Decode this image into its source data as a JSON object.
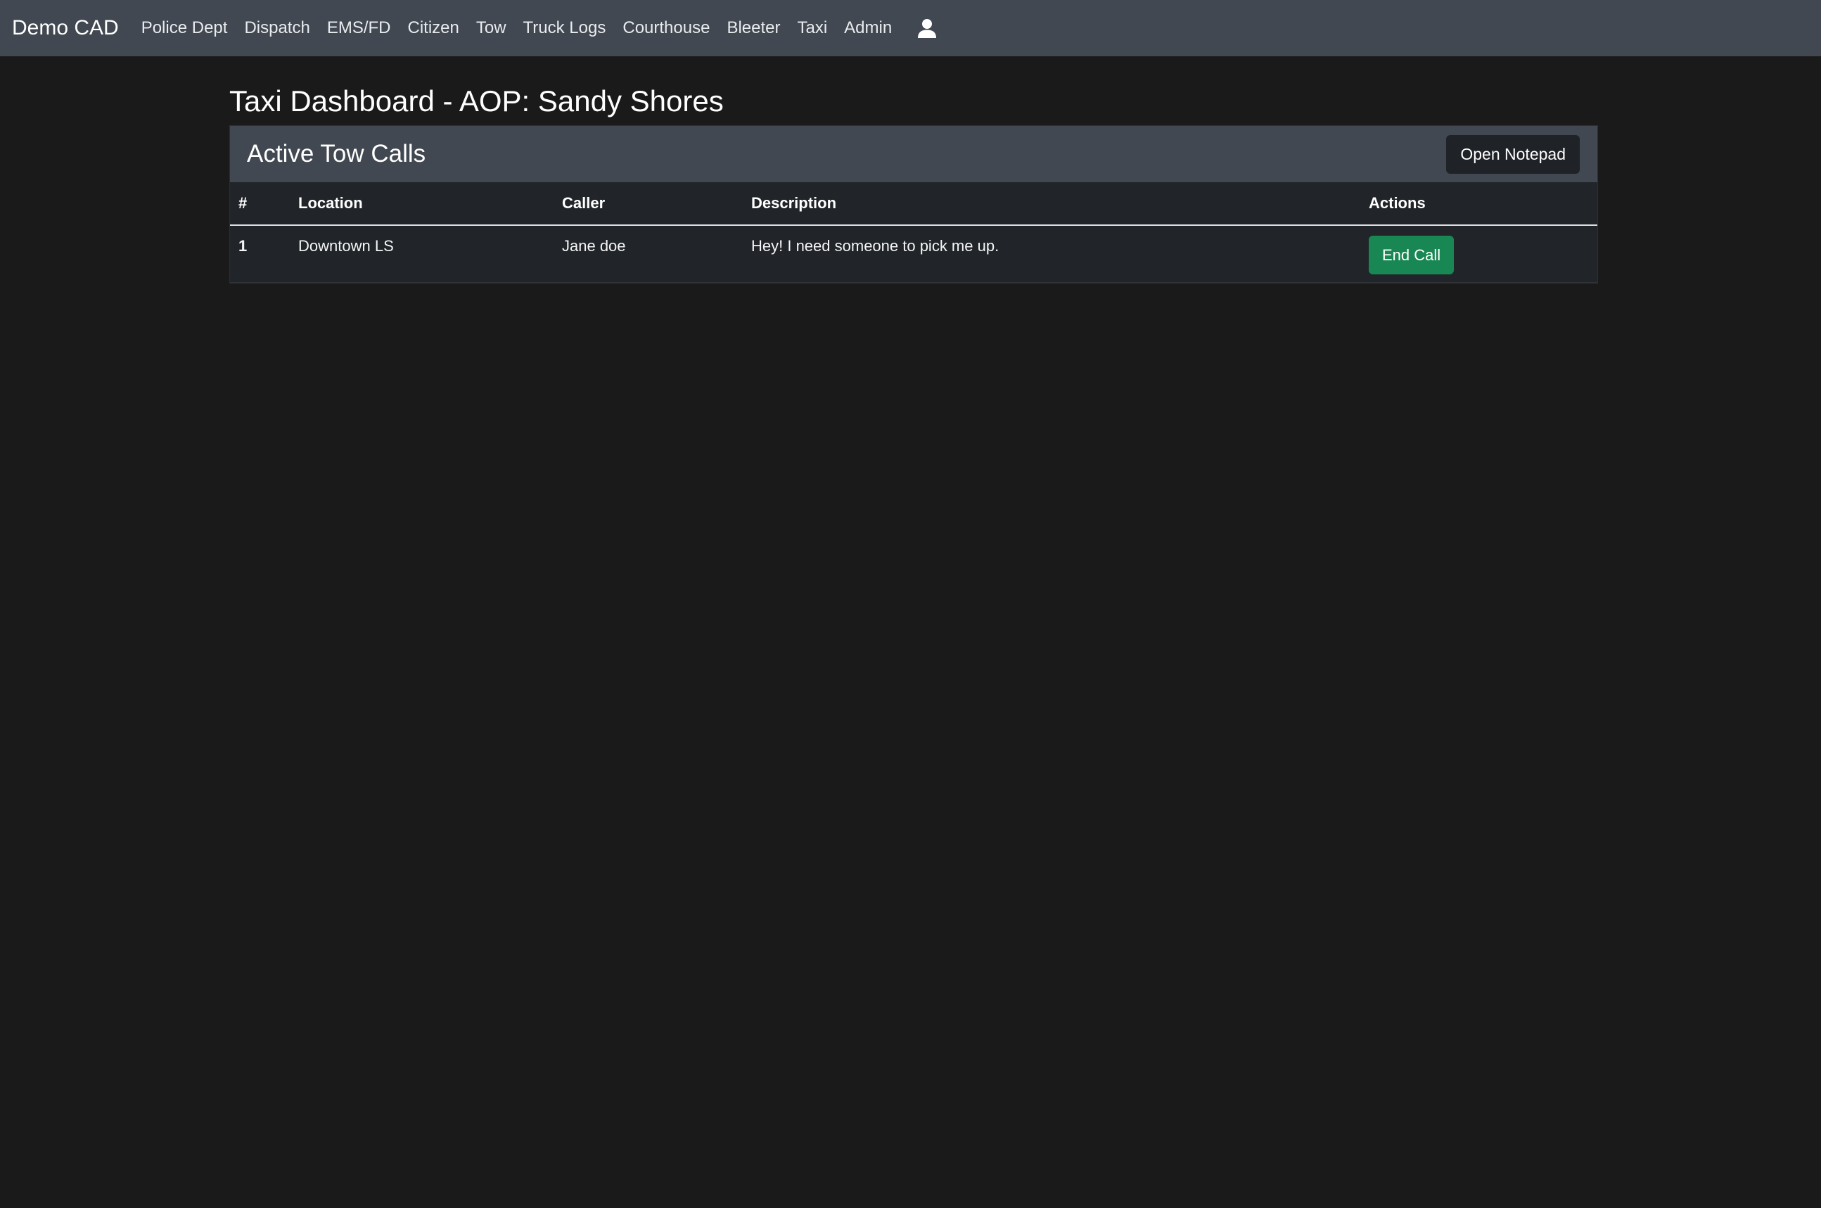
{
  "navbar": {
    "brand": "Demo CAD",
    "links": [
      "Police Dept",
      "Dispatch",
      "EMS/FD",
      "Citizen",
      "Tow",
      "Truck Logs",
      "Courthouse",
      "Bleeter",
      "Taxi",
      "Admin"
    ],
    "user_icon": "person-icon"
  },
  "page": {
    "title": "Taxi Dashboard - AOP: Sandy Shores"
  },
  "card": {
    "title": "Active Tow Calls",
    "notepad_button": "Open Notepad",
    "columns": [
      "#",
      "Location",
      "Caller",
      "Description",
      "Actions"
    ],
    "rows": [
      {
        "num": "1",
        "location": "Downtown LS",
        "caller": "Jane doe",
        "description": "Hey! I need someone to pick me up.",
        "action": "End Call"
      }
    ]
  },
  "colors": {
    "navbar": "#414851",
    "background": "#1a1a1a",
    "end_call": "#198754"
  }
}
